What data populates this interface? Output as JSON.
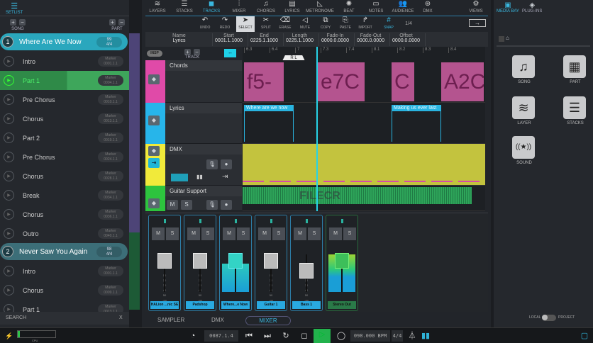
{
  "setlist": {
    "label": "SETLIST",
    "song_label": "SONG",
    "part_label": "PART",
    "songs": [
      {
        "num": "1",
        "title": "Where Are We Now",
        "badge_top": "99",
        "badge_bot": "4/4",
        "parts": [
          {
            "name": "Intro",
            "time": "0001.1.1"
          },
          {
            "name": "Part 1",
            "time": "0004.1.1"
          },
          {
            "name": "Pre Chorus",
            "time": "0010.1.1"
          },
          {
            "name": "Chorus",
            "time": "0013.1.1"
          },
          {
            "name": "Part 2",
            "time": "0019.1.1"
          },
          {
            "name": "Pre Chorus",
            "time": "0024.1.1"
          },
          {
            "name": "Chorus",
            "time": "0028.1.1"
          },
          {
            "name": "Break",
            "time": "0034.1.1"
          },
          {
            "name": "Chorus",
            "time": "0036.1.1"
          },
          {
            "name": "Outro",
            "time": "0040.1.1"
          }
        ]
      },
      {
        "num": "2",
        "title": "Never Saw You Again",
        "badge_top": "98",
        "badge_bot": "4/4",
        "parts": [
          {
            "name": "Intro",
            "time": "0001.1.1"
          },
          {
            "name": "Chorus",
            "time": "0009.1.1"
          },
          {
            "name": "Part 1",
            "time": "0013.1.1"
          }
        ]
      }
    ],
    "badge_label": "Marker",
    "search": "SEARCH",
    "search_clear": "X",
    "cpu": "CPU"
  },
  "nav": [
    "LAYERS",
    "STACKS",
    "TRACKS",
    "MIXER",
    "CHORDS",
    "LYRICS",
    "METRONOME",
    "BEAT",
    "NOTES",
    "AUDIENCE",
    "DMX",
    "VIEWS"
  ],
  "tools": [
    "UNDO",
    "REDO",
    "SELECT",
    "SPLIT",
    "ERASE",
    "MUTE",
    "COPY",
    "PASTE",
    "IMPORT",
    "SNAP"
  ],
  "snap_value": "1/4",
  "info": [
    {
      "k": "Name",
      "v": "Lyrics"
    },
    {
      "k": "Start",
      "v": "0001.1.1000"
    },
    {
      "k": "End",
      "v": "0225.1.1000"
    },
    {
      "k": "Length",
      "v": "0225.1.1000"
    },
    {
      "k": "Fade-In",
      "v": "0000.0.0000"
    },
    {
      "k": "Fade-Out",
      "v": "0000.0.0000"
    },
    {
      "k": "Offset",
      "v": "0000.0.0000"
    }
  ],
  "insp": "INSP",
  "track_label": "TRACK",
  "ruler": [
    "6.3",
    "6.4",
    "7",
    "7.3",
    "7.4",
    "8.1",
    "8.2",
    "8.3",
    "8.4"
  ],
  "loop": [
    "R",
    "L"
  ],
  "tracks": {
    "chords": "Chords",
    "lyrics": "Lyrics",
    "dmx": "DMX",
    "guitar": "Guitar Support",
    "m": "M",
    "s": "S"
  },
  "chords": [
    "f5-",
    "e7C",
    "C",
    "A2C"
  ],
  "lyrics": [
    "Where are we now",
    "Making us ever last"
  ],
  "mixer": {
    "channels": [
      "HALion ...nic SE",
      "Padshop",
      "Where...e Now",
      "Guitar 1",
      "Bass 1",
      "Stereo Out"
    ],
    "m": "M",
    "s": "S",
    "scale": [
      "0",
      "10",
      "20",
      "30",
      "40",
      "50",
      "-oo"
    ]
  },
  "tabs": [
    "SAMPLER",
    "DMX",
    "MIXER"
  ],
  "right": {
    "tabs": [
      "MEDIA BAY",
      "PLUG-INS"
    ],
    "items": [
      "SONG",
      "PART",
      "LAYER",
      "STACKS",
      "SOUND"
    ],
    "toggle": [
      "LOCAL",
      "PROJECT"
    ]
  },
  "transport": {
    "position": "0087.1.4",
    "tempo": "098.000 BPM",
    "signature": "4/4"
  },
  "watermark": "FILECR"
}
